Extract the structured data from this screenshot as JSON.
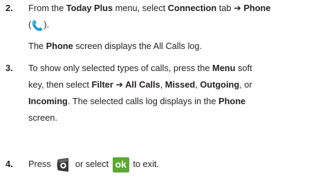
{
  "steps": [
    {
      "number": "2.",
      "text": {
        "a": "From the ",
        "b": "Today Plus",
        "c": " menu, select ",
        "d": "Connection",
        "e": " tab ",
        "f": "➔",
        "g": " Phone",
        "h": "(",
        "i": ").",
        "j": "The ",
        "k": "Phone",
        "l": " screen displays the All Calls log."
      },
      "icon": "phone-handset-icon"
    },
    {
      "number": "3.",
      "text": {
        "a": "To show only selected types of calls, press the ",
        "b": "Menu",
        "c": " soft",
        "d": "key, then select ",
        "e": "Filter ➔ All Calls",
        "f": ", ",
        "g": "Missed",
        "h": ", ",
        "i": "Outgoing",
        "j": ", or",
        "k": "Incoming",
        "l": ". The selected calls log displays in the ",
        "m": "Phone",
        "n": "screen."
      }
    },
    {
      "number": "4.",
      "text": {
        "a": "Press ",
        "b": " or select ",
        "c": " to exit."
      },
      "ok_label": "ok",
      "icons": [
        "end-key-icon",
        "ok-icon"
      ]
    }
  ],
  "colors": {
    "text": "#231f20",
    "phone_icon": "#1f9ad6",
    "ok_green": "#5aa832"
  }
}
